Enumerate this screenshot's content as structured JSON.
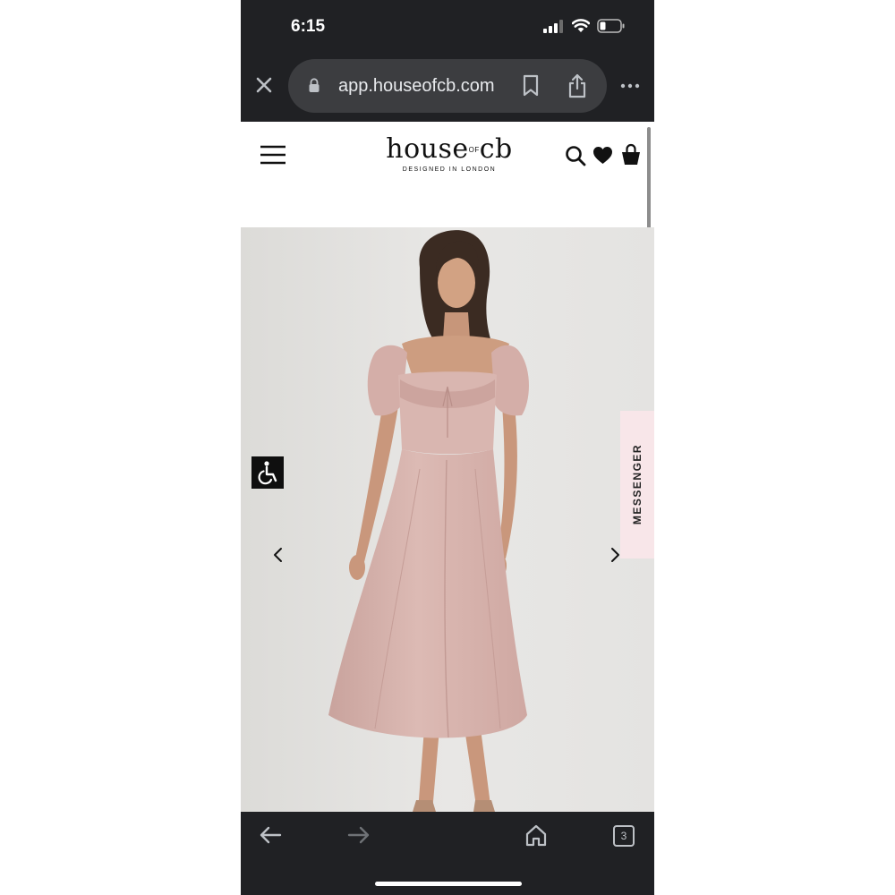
{
  "status_bar": {
    "time": "6:15",
    "icons": [
      "cellular-signal-icon",
      "wifi-icon",
      "battery-icon"
    ]
  },
  "browser": {
    "url": "app.houseofcb.com",
    "open_tabs": "3",
    "icons": [
      "close-icon",
      "lock-icon",
      "bookmark-icon",
      "share-icon",
      "more-icon",
      "back-arrow-icon",
      "forward-arrow-icon",
      "home-icon"
    ]
  },
  "site": {
    "logo_word": "house",
    "logo_small": "OF",
    "logo_end": "cb",
    "logo_tagline": "DESIGNED IN LONDON",
    "header_icons": [
      "menu-icon",
      "search-icon",
      "heart-icon",
      "bag-icon"
    ]
  },
  "gallery": {
    "image_subject": "woman in pink midi dress with puff sleeves",
    "icons": [
      "accessibility-icon",
      "chevron-left-icon",
      "chevron-right-icon"
    ],
    "messenger_label": "MESSENGER"
  },
  "colors": {
    "browser_chrome": "#202124",
    "url_pill": "#3c3d40",
    "gallery_background": "#e6e5e3",
    "dress": "#d8b4ae",
    "messenger_tab": "#f8e6e9"
  }
}
